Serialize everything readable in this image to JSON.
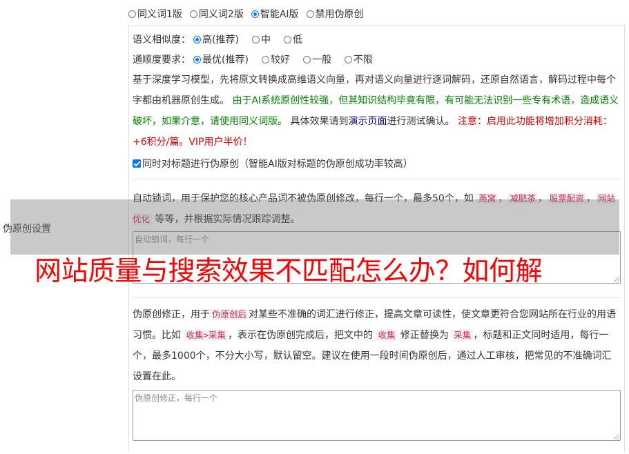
{
  "version_options": [
    {
      "label": "同义词1版",
      "checked": false
    },
    {
      "label": "同义词2版",
      "checked": false
    },
    {
      "label": "智能AI版",
      "checked": true
    },
    {
      "label": "禁用伪原创",
      "checked": false
    }
  ],
  "similarity": {
    "label": "语义相似度：",
    "options": [
      {
        "label": "高(推荐)",
        "checked": true
      },
      {
        "label": "中",
        "checked": false
      },
      {
        "label": "低",
        "checked": false
      }
    ]
  },
  "fluency": {
    "label": "通顺度要求：",
    "options": [
      {
        "label": "最优(推荐)",
        "checked": true
      },
      {
        "label": "较好",
        "checked": false
      },
      {
        "label": "一般",
        "checked": false
      },
      {
        "label": "不限",
        "checked": false
      }
    ]
  },
  "ai_desc": {
    "intro": "基于深度学习模型，先将原文转换成高维语义向量，再对语义向量进行逐词解码，还原自然语言，解码过程中每个字都由机器原创生成。",
    "warning_green": "由于AI系统原创性较强，但其知识结构毕竟有限，有可能无法识别一些专有术语，造成语义破坏，如果介意，请使用同义词版。",
    "test_prefix": "具体效果请到",
    "test_link": "演示页面",
    "test_suffix": "进行测试确认。",
    "cost_note": "注意：启用此功能将增加积分消耗：+6积分/篇。VIP用户半价！"
  },
  "title_checkbox": {
    "label": "同时对标题进行伪原创（智能AI版对标题的伪原创成功率较高）",
    "checked": true
  },
  "lock_words": {
    "desc_prefix": "自动锁词，用于保护您的核心产品词不被伪原创修改，每行一个，最多50个，如",
    "examples": [
      "燕窝",
      "减肥茶",
      "股票配资",
      "网站优化"
    ],
    "separator": "，",
    "desc_suffix": "等等，并根据实际情况跟踪调整。",
    "placeholder": "自动锁词，每行一个"
  },
  "correction": {
    "text_1": "伪原创修正，用于",
    "kw_1": "伪原创后",
    "text_2": "对某些不准确的词汇进行修正，提高文章可读性，使文章更符合您网站所在行业的用语习惯。比如",
    "kw_2": "收集>采集",
    "text_3": "，表示在伪原创完成后，把文中的",
    "kw_3": "收集",
    "text_4": "修正替换为",
    "kw_4": "采集",
    "text_5": "，标题和正文同时适用，每行一个，最多1000个，不分大小写，默认留空。建议在使用一段时间伪原创后，通过人工审核，把常见的不准确词汇设置在此。",
    "placeholder": "伪原创修正，每行一个"
  },
  "side_label": "伪原创设置",
  "overlay_title": "网站质量与搜索效果不匹配怎么办？如何解"
}
